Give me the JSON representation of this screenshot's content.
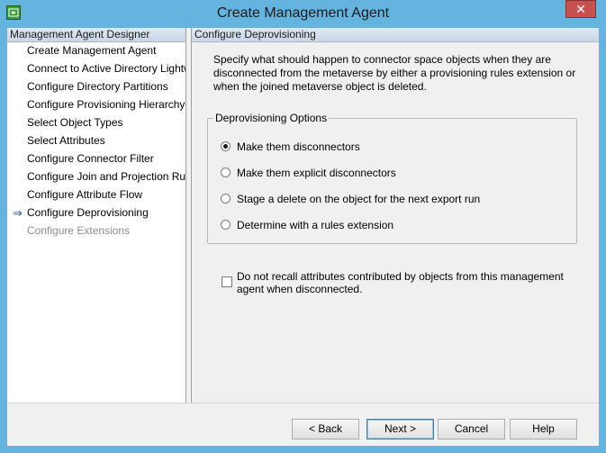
{
  "window": {
    "title": "Create Management Agent",
    "close_glyph": "✕",
    "icon": "management-agent-app-icon"
  },
  "left_pane": {
    "header": "Management Agent Designer",
    "current_marker": "⇒",
    "items": [
      {
        "label": "Create Management Agent",
        "state": "normal"
      },
      {
        "label": "Connect to Active Directory Lightweight Directory Services",
        "state": "normal"
      },
      {
        "label": "Configure Directory Partitions",
        "state": "normal"
      },
      {
        "label": "Configure Provisioning Hierarchy",
        "state": "normal"
      },
      {
        "label": "Select Object Types",
        "state": "normal"
      },
      {
        "label": "Select Attributes",
        "state": "normal"
      },
      {
        "label": "Configure Connector Filter",
        "state": "normal"
      },
      {
        "label": "Configure Join and Projection Rules",
        "state": "normal"
      },
      {
        "label": "Configure Attribute Flow",
        "state": "normal"
      },
      {
        "label": "Configure Deprovisioning",
        "state": "current"
      },
      {
        "label": "Configure Extensions",
        "state": "disabled"
      }
    ]
  },
  "right_pane": {
    "header": "Configure Deprovisioning",
    "description": "Specify what should happen to connector space objects when they are disconnected from the metaverse by either a provisioning rules extension or when the joined metaverse object is deleted.",
    "group": {
      "title": "Deprovisioning Options",
      "options": [
        {
          "label": "Make them disconnectors",
          "selected": true
        },
        {
          "label": "Make them explicit disconnectors",
          "selected": false
        },
        {
          "label": "Stage a delete on the object for the next export run",
          "selected": false
        },
        {
          "label": "Determine with a rules extension",
          "selected": false
        }
      ]
    },
    "checkbox": {
      "label": "Do not recall attributes contributed by objects from this management agent when disconnected.",
      "checked": false
    }
  },
  "buttons": {
    "back": "< Back",
    "next": "Next >",
    "cancel": "Cancel",
    "help": "Help"
  },
  "colors": {
    "window_frame": "#65b4df",
    "close_button": "#c75050",
    "pane_header": "#c9d6e6"
  }
}
